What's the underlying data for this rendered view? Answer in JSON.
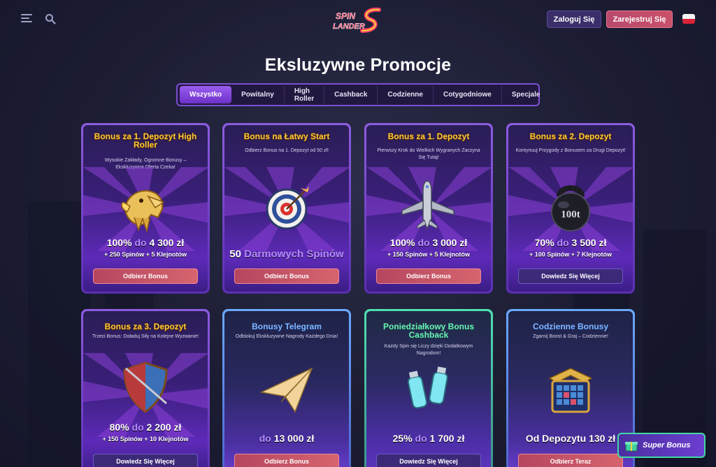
{
  "header": {
    "logo_text_1": "SPIN",
    "logo_text_2": "LANDER",
    "login_label": "Zaloguj Się",
    "register_label": "Zarejestruj Się"
  },
  "page": {
    "title": "Eksluzywne Promocje"
  },
  "tabs": [
    {
      "label": "Wszystko",
      "active": true
    },
    {
      "label": "Powitalny"
    },
    {
      "label": "High Roller"
    },
    {
      "label": "Cashback"
    },
    {
      "label": "Codzienne"
    },
    {
      "label": "Cotygodniowe"
    },
    {
      "label": "Specjale"
    }
  ],
  "cards": [
    {
      "title": "Bonus za 1. Depozyt High Roller",
      "desc": "Wysokie Zakłady, Ogromne Bonusy – Ekskluzywna Oferta Czeka!",
      "amount_main": "100%",
      "amount_mid": "do",
      "amount_val": "4 300 zł",
      "sub": "+ 250 Spinów + 5 Klejnotów",
      "cta": "Odbierz Bonus",
      "icon": "eagle-icon"
    },
    {
      "title": "Bonus na Łatwy Start",
      "desc": "Odbierz Bonus na 1. Depozyt od 50 zł!",
      "amount_main": "50",
      "amount_mid": "Darmowych Spinów",
      "amount_val": "",
      "sub": "",
      "cta": "Odbierz Bonus",
      "icon": "target-icon"
    },
    {
      "title": "Bonus za 1. Depozyt",
      "desc": "Pierwszy Krok do Wielkich Wygranych Zaczyna Się Tutaj!",
      "amount_main": "100%",
      "amount_mid": "do",
      "amount_val": "3 000 zł",
      "sub": "+ 150 Spinów + 5 Klejnotów",
      "cta": "Odbierz Bonus",
      "icon": "airplane-icon"
    },
    {
      "title": "Bonus za 2. Depozyt",
      "desc": "Kontynuuj Przygody z Bonusem za Drugi Depozyt!",
      "amount_main": "70%",
      "amount_mid": "do",
      "amount_val": "3 500 zł",
      "sub": "+ 100 Spinów + 7 Klejnotów",
      "cta": "Dowiedz Się Więcej",
      "icon": "kettlebell-icon",
      "kettlebell_text": "100t"
    },
    {
      "title": "Bonus za 3. Depozyt",
      "desc": "Trzeci Bonus: Doładuj Siły na Kolejne Wyzwanie!",
      "amount_main": "80%",
      "amount_mid": "do",
      "amount_val": "2 200 zł",
      "sub": "+ 150 Spinów + 10 Klejnotów",
      "cta": "Dowiedz Się Więcej",
      "icon": "shield-icon"
    },
    {
      "title": "Bonusy Telegram",
      "desc": "Odblokuj Ekskluzywne Nagrody Każdego Dnia!",
      "amount_main": "",
      "amount_mid": "do",
      "amount_val": "13 000 zł",
      "sub": "",
      "cta": "Odbierz Bonus",
      "icon": "paper-plane-icon"
    },
    {
      "title": "Poniedziałkowy Bonus Cashback",
      "desc": "Każdy Spin się Liczy dzięki Dodatkowym Nagrodom!",
      "amount_main": "25%",
      "amount_mid": "do",
      "amount_val": "1 700 zł",
      "sub": "",
      "cta": "Dowiedz Się Więcej",
      "icon": "battery-icon"
    },
    {
      "title": "Codzienne Bonusy",
      "desc": "Zgarnij Boost & Graj – Codziennie!",
      "amount_main": "Od Depozytu",
      "amount_mid": "",
      "amount_val": "130 zł",
      "sub": "",
      "cta": "Odbierz Teraz",
      "icon": "treasure-chest-icon"
    }
  ],
  "super_bonus": {
    "label": "Super Bonus"
  },
  "colors": {
    "accent": "#7c4fd3",
    "gold": "#ffc93a",
    "cta_red": "#c9506a"
  }
}
